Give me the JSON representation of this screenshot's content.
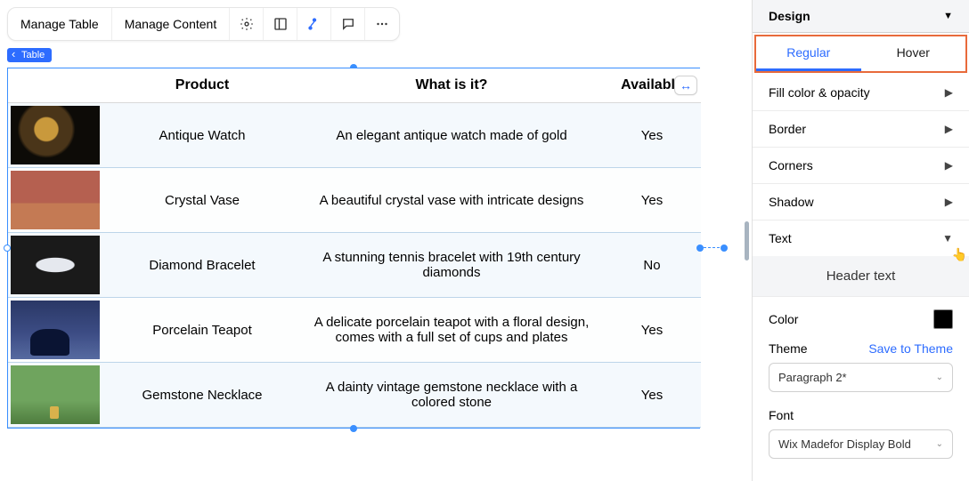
{
  "toolbar": {
    "manage_table": "Manage Table",
    "manage_content": "Manage Content"
  },
  "breadcrumb": "Table",
  "table": {
    "headers": {
      "product": "Product",
      "description": "What is it?",
      "available": "Available"
    },
    "rows": [
      {
        "product": "Antique Watch",
        "description": "An elegant antique watch made of gold",
        "available": "Yes"
      },
      {
        "product": "Crystal Vase",
        "description": "A beautiful crystal vase with intricate designs",
        "available": "Yes"
      },
      {
        "product": "Diamond Bracelet",
        "description": "A stunning tennis bracelet with 19th century diamonds",
        "available": "No"
      },
      {
        "product": "Porcelain Teapot",
        "description": "A delicate porcelain teapot with a floral design, comes with a full set of cups and plates",
        "available": "Yes"
      },
      {
        "product": "Gemstone Necklace",
        "description": "A dainty vintage gemstone necklace with a colored stone",
        "available": "Yes"
      }
    ]
  },
  "panel": {
    "title": "Design",
    "tabs": {
      "regular": "Regular",
      "hover": "Hover"
    },
    "accordion": {
      "fill": "Fill color & opacity",
      "border": "Border",
      "corners": "Corners",
      "shadow": "Shadow",
      "text": "Text"
    },
    "text_section": {
      "subheader": "Header text",
      "color_label": "Color",
      "theme_label": "Theme",
      "save_theme": "Save to Theme",
      "theme_value": "Paragraph 2*",
      "font_label": "Font",
      "font_value": "Wix Madefor Display Bold"
    },
    "color_swatch": "#000000"
  }
}
